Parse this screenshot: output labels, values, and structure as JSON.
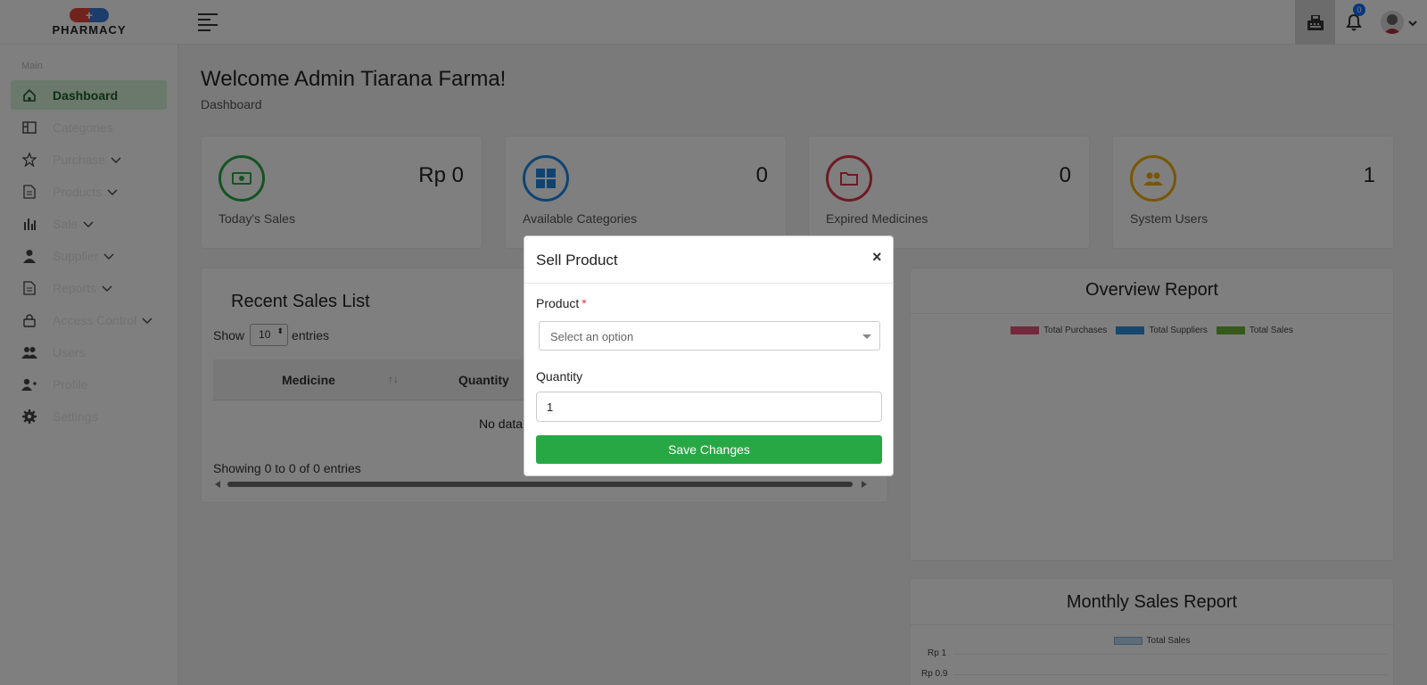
{
  "logo": {
    "text": "PHARMACY"
  },
  "header": {
    "notif_count": "0"
  },
  "sidebar": {
    "title": "Main",
    "items": [
      {
        "label": "Dashboard",
        "icon": "home-icon"
      },
      {
        "label": "Categories",
        "icon": "layout-icon"
      },
      {
        "label": "Purchase",
        "icon": "star-icon"
      },
      {
        "label": "Products",
        "icon": "file-icon"
      },
      {
        "label": "Sale",
        "icon": "bar-chart-icon"
      },
      {
        "label": "Supplier",
        "icon": "user-icon"
      },
      {
        "label": "Reports",
        "icon": "file-icon"
      },
      {
        "label": "Access Control",
        "icon": "lock-icon"
      },
      {
        "label": "Users",
        "icon": "users-icon"
      },
      {
        "label": "Profile",
        "icon": "user-plus-icon"
      },
      {
        "label": "Settings",
        "icon": "gear-icon"
      }
    ]
  },
  "page": {
    "welcome": "Welcome Admin Tiarana Farma!",
    "breadcrumb": "Dashboard"
  },
  "cards": [
    {
      "value": "Rp 0",
      "label": "Today's Sales",
      "color": "#28a745"
    },
    {
      "value": "0",
      "label": "Available Categories",
      "color": "#1e88e5"
    },
    {
      "value": "0",
      "label": "Expired Medicines",
      "color": "#dc3545"
    },
    {
      "value": "1",
      "label": "System Users",
      "color": "#f0ad00"
    }
  ],
  "recent": {
    "title": "Recent Sales List",
    "show": "Show",
    "entries": "entries",
    "length": "10",
    "columns": [
      "Medicine",
      "Quantity"
    ],
    "no_data": "No data",
    "info": "Showing 0 to 0 of 0 entries"
  },
  "overview": {
    "title": "Overview Report",
    "legend": [
      {
        "name": "Total Purchases",
        "color": "#e8517a"
      },
      {
        "name": "Total Suppliers",
        "color": "#2f8fd8"
      },
      {
        "name": "Total Sales",
        "color": "#6bb232"
      }
    ]
  },
  "monthly": {
    "title": "Monthly Sales Report",
    "legend": "Total Sales",
    "legend_color": "#bcd8f0",
    "yticks": [
      "Rp 1",
      "Rp 0.9"
    ]
  },
  "modal": {
    "title": "Sell Product",
    "close": "×",
    "product_label": "Product",
    "required": "*",
    "product_placeholder": "Select an option",
    "quantity_label": "Quantity",
    "quantity_value": "1",
    "save": "Save Changes"
  }
}
